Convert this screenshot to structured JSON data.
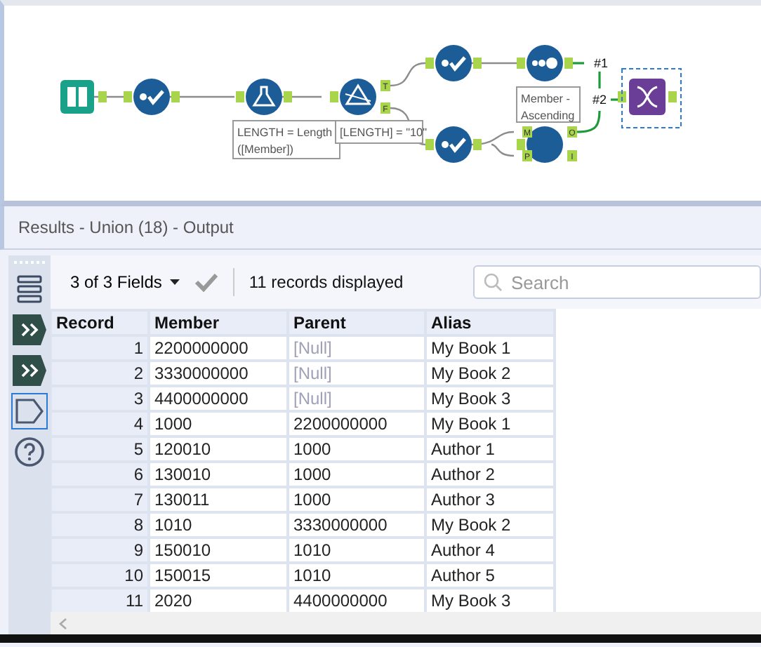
{
  "canvas": {
    "nodes": [
      {
        "kind": "input",
        "selected": false
      },
      {
        "kind": "select",
        "selected": false
      },
      {
        "kind": "formula",
        "selected": false
      },
      {
        "kind": "filter",
        "selected": false,
        "anchors": [
          "T",
          "F"
        ]
      },
      {
        "kind": "select",
        "selected": false
      },
      {
        "kind": "sample",
        "selected": false
      },
      {
        "kind": "select",
        "selected": false
      },
      {
        "kind": "join",
        "selected": false,
        "anchors": [
          "M",
          "P",
          "O",
          "I"
        ]
      },
      {
        "kind": "union",
        "selected": true
      }
    ],
    "annotations": [
      {
        "lines": [
          "LENGTH = Length",
          "([Member])"
        ]
      },
      {
        "lines": [
          "[LENGTH] = \"10\""
        ]
      },
      {
        "lines": [
          "Member -",
          "Ascending"
        ]
      }
    ],
    "connection_labels": [
      "#1",
      "#2"
    ]
  },
  "results": {
    "title": "Results - Union (18) - Output",
    "sidebar": [
      {
        "kind": "list",
        "selected": false
      },
      {
        "kind": "chevrons",
        "selected": false
      },
      {
        "kind": "chevrons",
        "selected": false
      },
      {
        "kind": "tag",
        "selected": true
      },
      {
        "kind": "help",
        "selected": false
      }
    ],
    "toolbar": {
      "fields": "3 of 3 Fields",
      "records": "11 records displayed",
      "search_placeholder": "Search"
    },
    "table": {
      "columns": [
        "Record",
        "Member",
        "Parent",
        "Alias"
      ],
      "rows": [
        {
          "record": "1",
          "member": "2200000000",
          "parent": "[Null]",
          "parent_null": true,
          "alias": "My Book 1"
        },
        {
          "record": "2",
          "member": "3330000000",
          "parent": "[Null]",
          "parent_null": true,
          "alias": "My Book 2"
        },
        {
          "record": "3",
          "member": "4400000000",
          "parent": "[Null]",
          "parent_null": true,
          "alias": "My Book 3"
        },
        {
          "record": "4",
          "member": "1000",
          "parent": "2200000000",
          "parent_null": false,
          "alias": "My Book 1"
        },
        {
          "record": "5",
          "member": "120010",
          "parent": "1000",
          "parent_null": false,
          "alias": "Author 1"
        },
        {
          "record": "6",
          "member": "130010",
          "parent": "1000",
          "parent_null": false,
          "alias": "Author 2"
        },
        {
          "record": "7",
          "member": "130011",
          "parent": "1000",
          "parent_null": false,
          "alias": "Author 3"
        },
        {
          "record": "8",
          "member": "1010",
          "parent": "3330000000",
          "parent_null": false,
          "alias": "My Book 2"
        },
        {
          "record": "9",
          "member": "150010",
          "parent": "1010",
          "parent_null": false,
          "alias": "Author 4"
        },
        {
          "record": "10",
          "member": "150015",
          "parent": "1010",
          "parent_null": false,
          "alias": "Author 5"
        },
        {
          "record": "11",
          "member": "2020",
          "parent": "4400000000",
          "parent_null": false,
          "alias": "My Book 3"
        }
      ]
    }
  }
}
